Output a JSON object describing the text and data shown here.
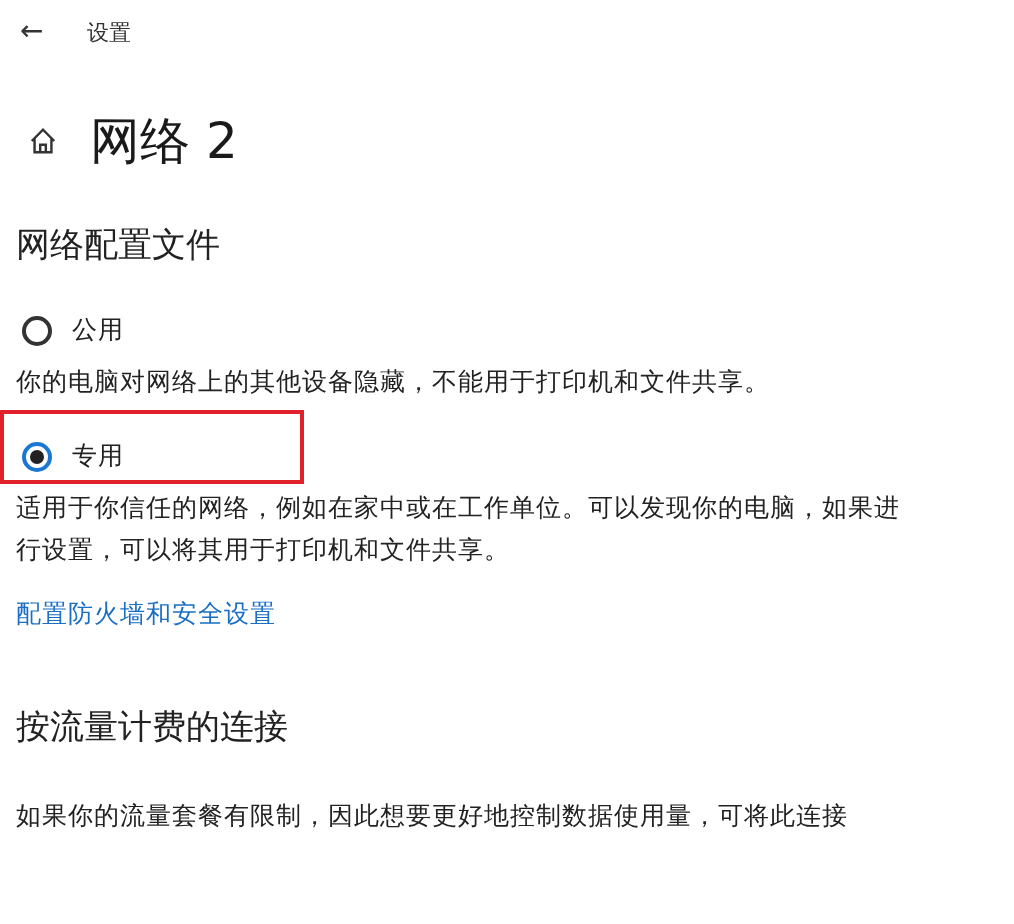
{
  "header": {
    "back": "←",
    "title": "设置"
  },
  "page_title": "网络 2",
  "profile_section": {
    "heading": "网络配置文件",
    "options": [
      {
        "label": "公用",
        "selected": false,
        "highlighted": false,
        "description": "你的电脑对网络上的其他设备隐藏，不能用于打印机和文件共享。"
      },
      {
        "label": "专用",
        "selected": true,
        "highlighted": true,
        "description": "适用于你信任的网络，例如在家中或在工作单位。可以发现你的电脑，如果进行设置，可以将其用于打印机和文件共享。"
      }
    ],
    "link": "配置防火墙和安全设置"
  },
  "metered_section": {
    "heading": "按流量计费的连接",
    "description": "如果你的流量套餐有限制，因此想要更好地控制数据使用量，可将此连接"
  }
}
